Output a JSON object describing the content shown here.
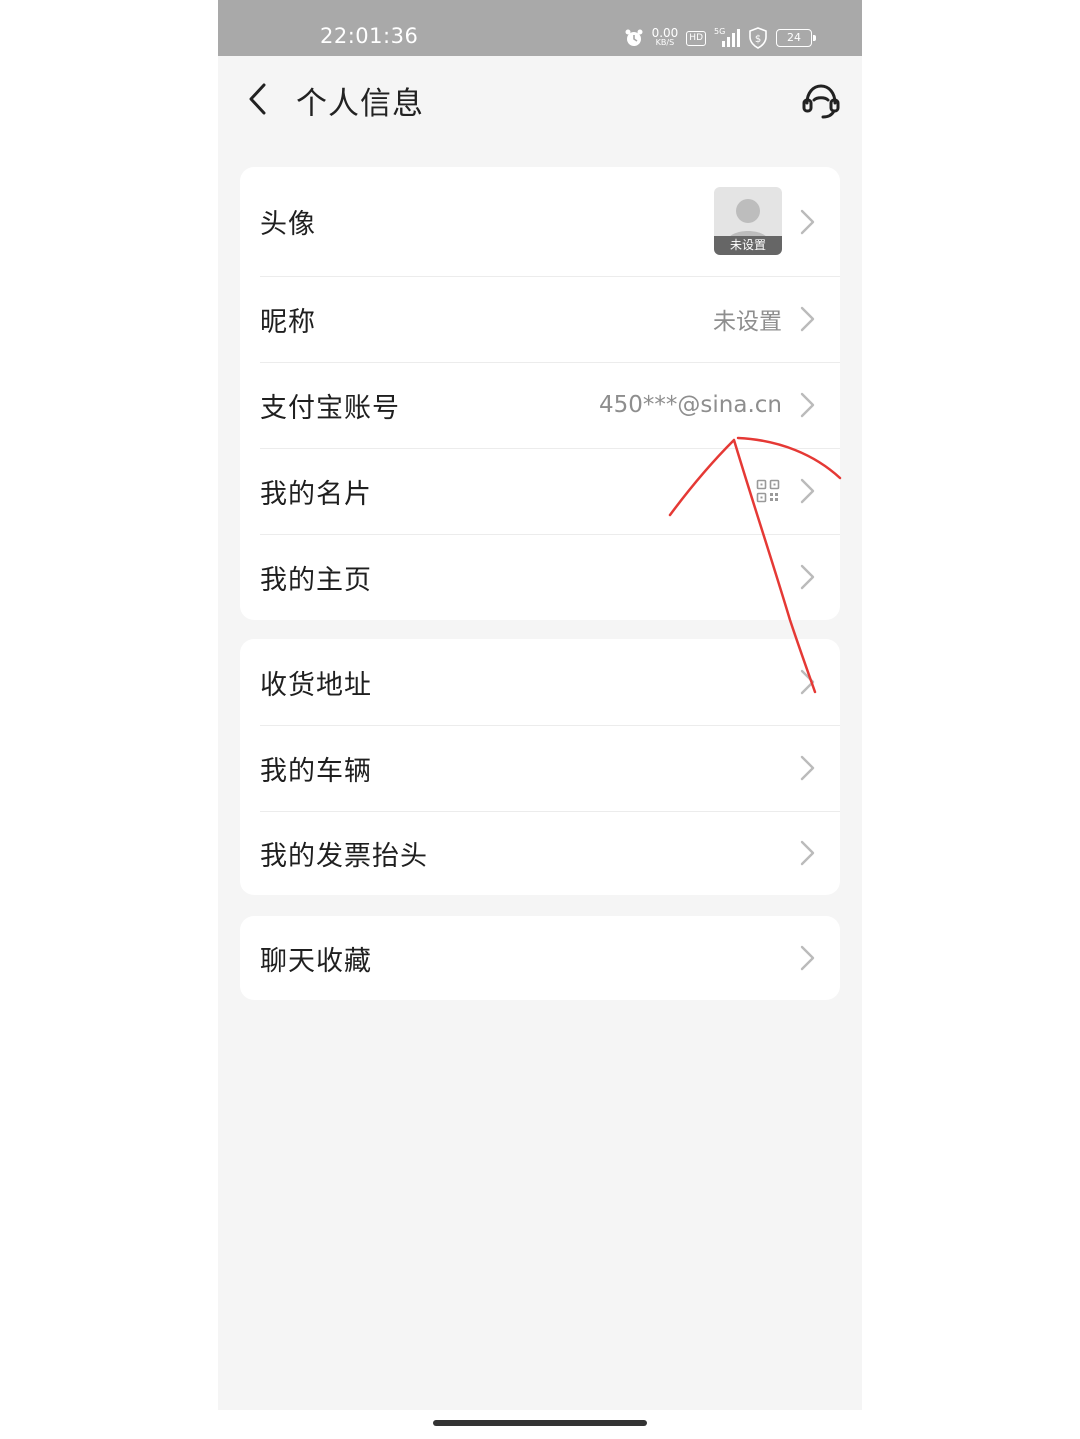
{
  "status_bar": {
    "time": "22:01:36",
    "net_speed": "0.00",
    "net_unit": "KB/S",
    "hd": "HD",
    "signal": "5G",
    "battery": "24"
  },
  "header": {
    "title": "个人信息"
  },
  "groups": [
    {
      "items": [
        {
          "label": "头像",
          "avatar_tag": "未设置"
        },
        {
          "label": "昵称",
          "value": "未设置"
        },
        {
          "label": "支付宝账号",
          "value": "450***@sina.cn"
        },
        {
          "label": "我的名片"
        },
        {
          "label": "我的主页"
        }
      ]
    },
    {
      "items": [
        {
          "label": "收货地址"
        },
        {
          "label": "我的车辆"
        },
        {
          "label": "我的发票抬头"
        }
      ]
    },
    {
      "items": [
        {
          "label": "聊天收藏"
        }
      ]
    }
  ],
  "colors": {
    "annotation": "#e53935",
    "background": "#f5f5f5",
    "card": "#ffffff"
  },
  "icons": [
    "back-arrow-icon",
    "customer-service-icon",
    "chevron-right-icon",
    "qr-code-icon",
    "avatar-placeholder-icon"
  ]
}
